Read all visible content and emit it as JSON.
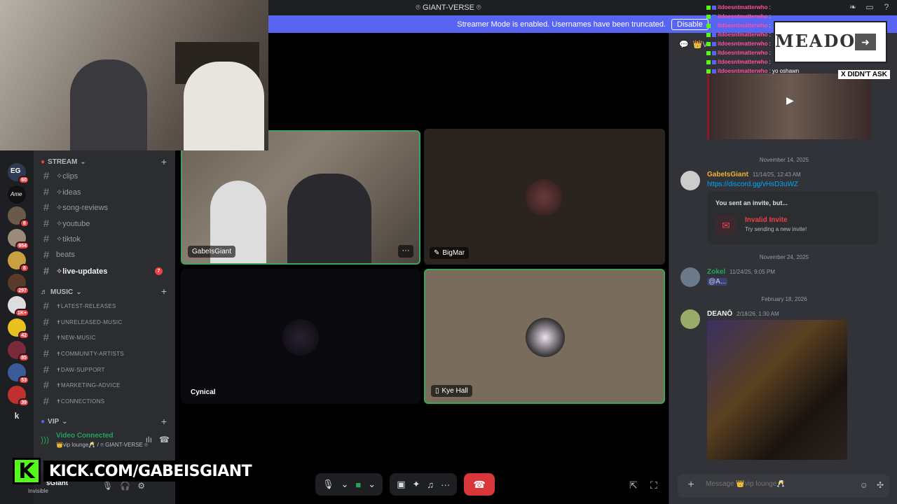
{
  "titlebar": {
    "server_name": "⌾ GIANT-VERSE ⌾"
  },
  "streamer_mode": {
    "message": "Streamer Mode is enabled. Usernames have been truncated.",
    "button": "Disable"
  },
  "guild_badges": [
    "60",
    "8",
    "954",
    "8",
    "297",
    "1K+",
    "42",
    "85",
    "53",
    "39"
  ],
  "guild_letter": "k",
  "categories": {
    "stream": "STREAM",
    "music": "MUSIC",
    "vip": "VIP"
  },
  "stream_channels": [
    "✧clips",
    "✧ideas",
    "✧song-reviews",
    "✧youtube",
    "✧tiktok",
    "beats",
    "✧live-updates"
  ],
  "live_updates_unread": "7",
  "music_channels": [
    "✝LATEST-RELEASES",
    "✝UNRELEASED-MUSIC",
    "✝NEW-MUSIC",
    "✝COMMUNITY-ARTISTS",
    "✝DAW-SUPPORT",
    "✝MARKETING-ADVICE",
    "✝CONNECTIONS"
  ],
  "voice": {
    "status": "Video Connected",
    "channel": "👑vip lounge🥂 / ⌾ GIANT-VERSE ⌾"
  },
  "user": {
    "name": "sGiant",
    "status": "Invisible"
  },
  "tiles": {
    "tile1": "GabeIsGiant",
    "tile2": "BigMar",
    "tile3": "Cynical",
    "tile4": "Kye Hall"
  },
  "kick_banner": "KICK.COM/GABEISGIANT",
  "chat_overlay": {
    "user": "itdoesntmatterwho",
    "lines": [
      ": ",
      ": ",
      ": ",
      ": ",
      ": ",
      ": ",
      ": ",
      ": yo oshawn"
    ]
  },
  "song_overlay": {
    "title": "MEADOW",
    "note": "X DIDN'T ASK"
  },
  "chat": {
    "header_channel": "👑V",
    "dates": [
      "November 14, 2025",
      "November 24, 2025",
      "February 18, 2026"
    ],
    "messages": [
      {
        "author": "GabeIsGiant",
        "time": "11/14/25, 12:43 AM",
        "text": "https://discord.gg/vHsD3uWZ",
        "color": "#f0b232"
      },
      {
        "author": "Zokel",
        "time": "11/24/25, 9:05 PM",
        "text": "@A...",
        "color": "#23a55a"
      },
      {
        "author": "DEANŌ",
        "time": "2/18/26, 1:30 AM",
        "text": "",
        "color": "#f2f3f5"
      }
    ],
    "invite": {
      "title": "You sent an invite, but...",
      "name": "Invalid Invite",
      "sub": "Try sending a new invite!"
    },
    "input_placeholder": "Message 👑vip lounge🥂"
  },
  "colors": {
    "accent": "#5865f2",
    "green": "#23a55a",
    "red": "#da373c",
    "kick": "#53fc18"
  }
}
